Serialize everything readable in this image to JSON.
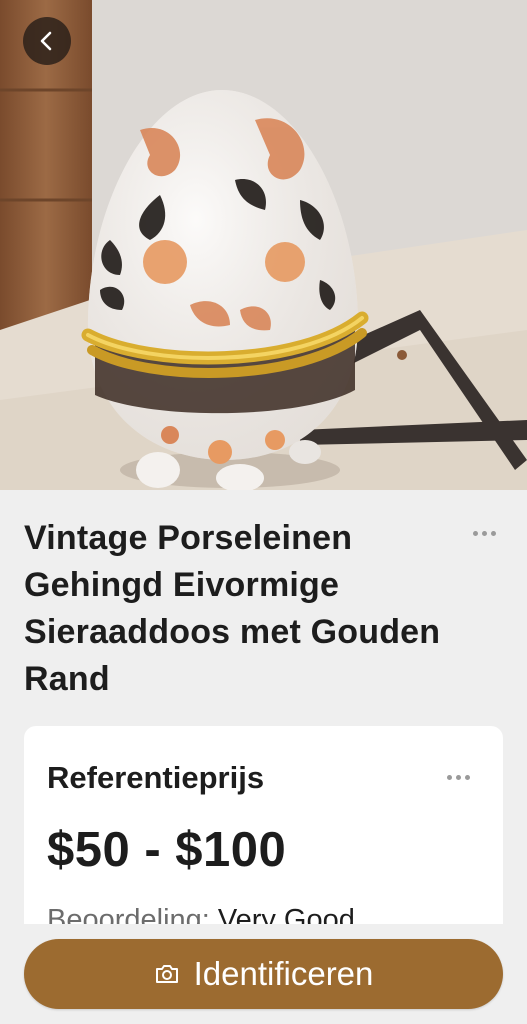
{
  "product": {
    "title": "Vintage Porseleinen Gehingd Eivormige Sieraaddoos met Gouden Rand",
    "image_alt": "Porcelain egg-shaped jewelry box with gold rim"
  },
  "reference": {
    "label": "Referentieprijs",
    "price": "$50 - $100",
    "rating_label": "Beoordeling:",
    "rating_value": "Very Good"
  },
  "actions": {
    "identify_label": "Identificeren"
  },
  "icons": {
    "back": "chevron-left-icon",
    "more": "more-horizontal-icon",
    "camera": "camera-icon"
  },
  "colors": {
    "accent": "#9c6b30",
    "background": "#efefef",
    "card": "#ffffff",
    "text": "#1d1d1d"
  }
}
